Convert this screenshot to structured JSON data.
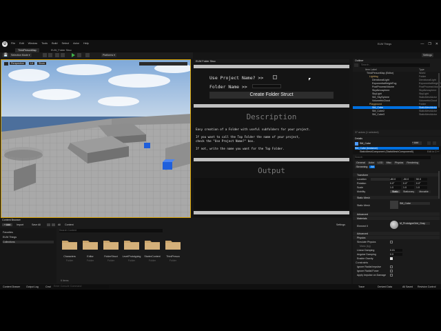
{
  "title_bar": {
    "logo": "U",
    "menu": [
      "File",
      "Edit",
      "Window",
      "Tools",
      "Build",
      "Select",
      "Actor",
      "Help"
    ],
    "project_name": "EUW Things",
    "window_controls": [
      "—",
      "❐",
      "✕"
    ]
  },
  "tabs": {
    "level_tab": "ThirdPersonMap",
    "widget_tab": "EUW_Folder Struc",
    "tool_tab": "EUW Folder Struc"
  },
  "toolbar": {
    "save": "💾",
    "selection_mode": "Selection Mode",
    "platforms": "Platforms",
    "settings": "Settings"
  },
  "viewport": {
    "perspective": "Perspective",
    "lit": "Lit",
    "show": "Show"
  },
  "folder_tool": {
    "use_project_name_label": "Use Project Name? >>",
    "folder_name_label": "Folder Name >>",
    "create_button": "Create Folder Struct",
    "description_title": "Description",
    "description_lines": [
      "Easy creation of a Folder with useful subfolders for your project.",
      "",
      "If you want to call the Top Folder the name of your project,",
      "check the \"Use Project Name?\" box.",
      "",
      "If not, write the name you want for the Top Folder."
    ],
    "output_title": "Output"
  },
  "outliner": {
    "title": "Outliner",
    "search_placeholder": "Search...",
    "item_label_header": "Item Label",
    "type_header": "Type",
    "rows": [
      {
        "label": "ThirdPersonMap (Editor)",
        "type": "World"
      },
      {
        "label": "Lighting",
        "type": "Folder"
      },
      {
        "label": "DirectionalLight",
        "type": "DirectionalLight"
      },
      {
        "label": "ExponentialHeightFog",
        "type": "ExponentialHeightFog"
      },
      {
        "label": "PostProcessVolume",
        "type": "PostProcessVolume"
      },
      {
        "label": "SkyAtmosphere",
        "type": "SkyAtmosphere"
      },
      {
        "label": "SkyLight",
        "type": "SkyLight"
      },
      {
        "label": "SM_SkySphere",
        "type": "StaticMeshActor"
      },
      {
        "label": "VolumetricCloud",
        "type": "VolumetricCloud"
      },
      {
        "label": "Playground",
        "type": "Folder"
      },
      {
        "label": "SM_Cube",
        "type": "StaticMeshActor"
      },
      {
        "label": "SM_Cube2",
        "type": "StaticMeshActor"
      },
      {
        "label": "SM_Cube3",
        "type": "StaticMeshActor"
      }
    ],
    "status": "37 actors (1 selected)"
  },
  "details": {
    "title": "Details",
    "actor_name": "SM_Cube",
    "add_button": "+ Add",
    "component_root": "SM_Cube (Instance)",
    "component_child": "StaticMeshComponent (StaticMeshComponent0)",
    "edit_in_cpp": "Edit in C++",
    "search_placeholder": "Search",
    "filter_tabs": [
      "General",
      "Actor",
      "LOD",
      "Misc",
      "Physics",
      "Rendering",
      "Streaming",
      "All"
    ],
    "transform_header": "Transform",
    "location_label": "Location",
    "rotation_label": "Rotation",
    "scale_label": "Scale",
    "location": [
      "-80.0",
      "-50.0",
      "50.0"
    ],
    "rotation": [
      "0.0°",
      "0.0°",
      "0.0°"
    ],
    "scale": [
      "1.0",
      "1.0",
      "1.0"
    ],
    "mobility_label": "Mobility",
    "mobility_options": [
      "Static",
      "Stationary",
      "Movable"
    ],
    "static_mesh_header": "Static Mesh",
    "static_mesh_label": "Static Mesh",
    "static_mesh_value": "SM_Cube",
    "advanced": "Advanced",
    "materials_header": "Materials",
    "element0_label": "Element 0",
    "element0_value": "M_PrototypeGrid_Gray",
    "physics_header": "Physics",
    "physics_rows": [
      "Simulate Physics",
      "Mass (kg)",
      "Linear Damping",
      "Angular Damping",
      "Enable Gravity"
    ],
    "physics_values": [
      "",
      "",
      "0.01",
      "0.0",
      ""
    ],
    "constraints_header": "Constraints",
    "collision_rows": [
      "Ignore Radial Impulse",
      "Ignore Radial Force",
      "Apply Impulse on Damage"
    ]
  },
  "content_browser": {
    "title": "Content Browser",
    "add_button": "+ Add",
    "import_button": "Import",
    "save_all_button": "Save All",
    "breadcrumb": [
      "All",
      "Content"
    ],
    "settings": "Settings",
    "favorites": "Favorites",
    "project": "EUW Things",
    "collections": "Collections",
    "search_placeholder": "Search Content",
    "folders": [
      {
        "name": "Characters",
        "sub": "Folder"
      },
      {
        "name": "Editor",
        "sub": "Folder"
      },
      {
        "name": "FolderStruct",
        "sub": "Folder"
      },
      {
        "name": "LevelPrototyping",
        "sub": "Folder"
      },
      {
        "name": "StarterContent",
        "sub": "Folder"
      },
      {
        "name": "ThirdPerson",
        "sub": "Folder"
      }
    ],
    "item_count": "6 items"
  },
  "status_bar": {
    "content_drawer": "Content Drawer",
    "output_log": "Output Log",
    "cmd": "Cmd",
    "console_placeholder": "Enter Console Command",
    "trace": "Trace",
    "derived_data": "Derived Data",
    "all_saved": "All Saved",
    "revision_control": "Revision Control"
  },
  "colors": {
    "selection": "#d8a200",
    "accent_blue": "#0070e0",
    "folder": "#c8a36a"
  }
}
